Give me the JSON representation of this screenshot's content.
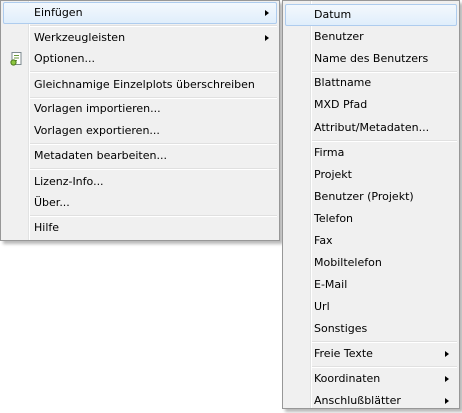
{
  "main_menu": {
    "einfuegen": "Einfügen",
    "werkzeugleisten": "Werkzeugleisten",
    "optionen": "Optionen...",
    "gleichnamige": "Gleichnamige Einzelplots überschreiben",
    "vorlagen_importieren": "Vorlagen importieren...",
    "vorlagen_exportieren": "Vorlagen exportieren...",
    "metadaten_bearbeiten": "Metadaten bearbeiten...",
    "lizenz_info": "Lizenz-Info...",
    "ueber": "Über...",
    "hilfe": "Hilfe",
    "optionen_icon": "options-icon"
  },
  "submenu": {
    "datum": "Datum",
    "benutzer": "Benutzer",
    "name_des_benutzers": "Name des Benutzers",
    "blattname": "Blattname",
    "mxd_pfad": "MXD Pfad",
    "attribut_metadaten": "Attribut/Metadaten...",
    "firma": "Firma",
    "projekt": "Projekt",
    "benutzer_projekt": "Benutzer (Projekt)",
    "telefon": "Telefon",
    "fax": "Fax",
    "mobiltelefon": "Mobiltelefon",
    "email": "E-Mail",
    "url": "Url",
    "sonstiges": "Sonstiges",
    "freie_texte": "Freie Texte",
    "koordinaten": "Koordinaten",
    "anschlussblaetter": "Anschlußblätter"
  },
  "colors": {
    "menu_background": "#f0f0f0",
    "menu_border": "#979797",
    "highlight_border": "#aeccee",
    "highlight_fill": "#e0eefb"
  }
}
